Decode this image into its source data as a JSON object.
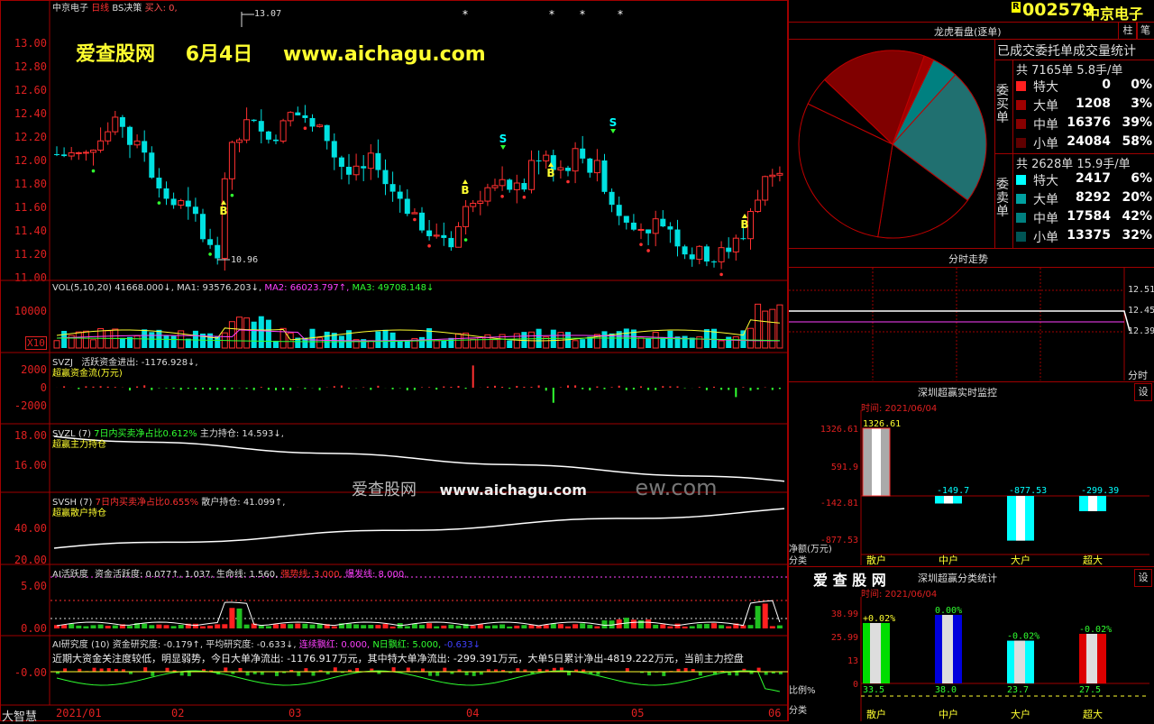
{
  "header": {
    "stock_name": "中京电子",
    "period": "日线",
    "indicator": "BS决策",
    "buy_label": "买入: 0,",
    "watermark_title": "爱查股网",
    "watermark_date": "6月4日",
    "watermark_url": "www.aichagu.com",
    "high_mark": "13.07",
    "low_mark": "10.96"
  },
  "price_axis": [
    "13.00",
    "12.80",
    "12.60",
    "12.40",
    "12.20",
    "12.00",
    "11.80",
    "11.60",
    "11.40",
    "11.20",
    "11.00"
  ],
  "signals": {
    "buy": "B",
    "sell": "S"
  },
  "vol": {
    "title": "VOL(5,10,20)",
    "value": "41668.000↓,",
    "ma1": "MA1: 93576.203↓,",
    "ma2": "MA2: 66023.797↑,",
    "ma3": "MA3: 49708.148↓",
    "axis": "10000",
    "unit": "X10"
  },
  "svzj": {
    "title": "SVZJ",
    "desc": "活跃资金进出: -1176.928↓,",
    "sub": "超赢资金流(万元)",
    "axis": [
      "2000",
      "0",
      "-2000"
    ]
  },
  "svzl": {
    "title": "SVZL",
    "desc1": "(7)",
    "desc2": "7日内买卖净占比0.612%",
    "desc3": "主力持仓: 14.593↓,",
    "sub": "超赢主力持仓",
    "axis": [
      "18.00",
      "16.00"
    ]
  },
  "svsh": {
    "title": "SVSH",
    "desc1": "(7)",
    "desc2": "7日内买卖净占比0.655%",
    "desc3": "散户持仓: 41.099↑,",
    "sub": "超赢散户持仓",
    "axis": [
      "40.00",
      "20.00"
    ]
  },
  "center_watermark": {
    "a": "爱查股网",
    "b": "www.aichagu.com",
    "c": "ew.com"
  },
  "ai_active": {
    "title": "AI活跃度",
    "d1": "资金活跃度: 0.077↑,",
    "d2": "1.037,",
    "d3": "生命线: 1.560,",
    "d4": "强势线: 3.000,",
    "d5": "爆发线: 8.000,",
    "axis": [
      "5.00",
      "0.00"
    ]
  },
  "ai_research": {
    "title": "AI研究度",
    "d1": "(10)",
    "d2": "资金研究度: -0.179↑,",
    "d3": "平均研究度: -0.633↓,",
    "d4": "连续飘红: 0.000,",
    "d5": "N日飘红: 5.000,",
    "d6": "-0.633↓",
    "line2": "近期大资金关注度较低，明显弱势，今日大单净流出: -1176.917万元，其中特大单净流出: -299.391万元，大单5日累计净出-4819.222万元，当前主力控盘",
    "axis": "-0.00"
  },
  "left_label": "大智慧",
  "dates": [
    "2021/01",
    "02",
    "03",
    "04",
    "05",
    "06"
  ],
  "right": {
    "badge": "R",
    "code": "002579",
    "name": "中京电子",
    "tab1": "柱",
    "tab2": "笔",
    "dragon_title": "龙虎看盘(逐单)",
    "dragon_sub": "已成交委托单成交量统计",
    "buy_side_label": "委买单",
    "sell_side_label": "委卖单",
    "buy_total": "共 7165单 5.8手/单",
    "sell_total": "共 2628单 15.9手/单",
    "buy_rows": [
      {
        "label": "特大",
        "num": "0",
        "pct": "0%",
        "color": "#ff2020"
      },
      {
        "label": "大单",
        "num": "1208",
        "pct": "3%",
        "color": "#a00000"
      },
      {
        "label": "中单",
        "num": "16376",
        "pct": "39%",
        "color": "#880000"
      },
      {
        "label": "小单",
        "num": "24084",
        "pct": "58%",
        "color": "#600000"
      }
    ],
    "sell_rows": [
      {
        "label": "特大",
        "num": "2417",
        "pct": "6%",
        "color": "#00ffff"
      },
      {
        "label": "大单",
        "num": "8292",
        "pct": "20%",
        "color": "#00a0a0"
      },
      {
        "label": "中单",
        "num": "17584",
        "pct": "42%",
        "color": "#008080"
      },
      {
        "label": "小单",
        "num": "13375",
        "pct": "32%",
        "color": "#005555"
      }
    ],
    "pie": [
      {
        "pct": 0.8,
        "color": "#ffffff"
      },
      {
        "pct": 2.6,
        "color": "#00ffff"
      },
      {
        "pct": 11.8,
        "color": "#008080"
      },
      {
        "pct": 23.5,
        "color": "#207070"
      },
      {
        "pct": 17.3,
        "color": "#000000"
      },
      {
        "pct": 29.6,
        "color": "#000000"
      },
      {
        "pct": 5,
        "color": "#000000"
      },
      {
        "pct": 18.4,
        "color": "#800000"
      },
      {
        "pct": 1.7,
        "color": "#a00000"
      }
    ],
    "timeshare_title": "分时走势",
    "timeshare_prices": [
      "12.51",
      "12.45",
      "12.39"
    ],
    "timeshare_label": "分时",
    "monitor_title": "深圳超赢实时监控",
    "monitor_set": "设",
    "monitor_time": "时间: 2021/06/04",
    "monitor_axis": [
      "1326.61",
      "591.9",
      "-142.81",
      "-877.53"
    ],
    "monitor_ylabel": "净额(万元)",
    "monitor_xlabel": "分类",
    "monitor_bars": [
      {
        "label": "散户",
        "value": "1326.61"
      },
      {
        "label": "中户",
        "value": "-149.7"
      },
      {
        "label": "大户",
        "value": "-877.53"
      },
      {
        "label": "超大",
        "value": "-299.39"
      }
    ],
    "class_logo": "爱 查 股 网",
    "class_title": "深圳超赢分类统计",
    "class_set": "设",
    "class_time": "时间: 2021/06/04",
    "class_axis": [
      "38.99",
      "25.99",
      "13",
      "0"
    ],
    "class_ylabel": "比例%",
    "class_xlabel": "分类",
    "class_bars": [
      {
        "label": "散户",
        "top": "+0.02%",
        "bottom": "33.5",
        "value": 33.5,
        "color": "#00dd00"
      },
      {
        "label": "中户",
        "top": "0.00%",
        "bottom": "38.0",
        "value": 38.0,
        "color": "#0000dd"
      },
      {
        "label": "大户",
        "top": "-0.02%",
        "bottom": "23.7",
        "value": 23.7,
        "color": "#00ffff"
      },
      {
        "label": "超大",
        "top": "-0.02%",
        "bottom": "27.5",
        "value": 27.5,
        "color": "#dd0000"
      }
    ]
  }
}
